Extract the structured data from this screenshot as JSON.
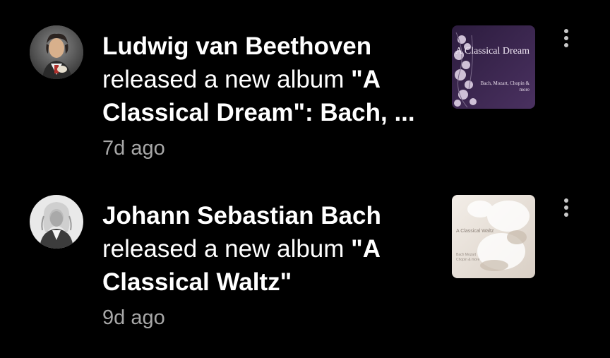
{
  "notifications": [
    {
      "artist": "Ludwig van Beethoven",
      "line2_regular": "released a new album ",
      "line2_bold": "\"A",
      "line3_bold": "Classical Dream\": Bach, ...",
      "time": "7d ago",
      "thumbnail": {
        "title": "A Classical Dream",
        "subtitle": "Bach, Mozart, Chopin & more",
        "colors": [
          "#3b2650",
          "#6a4d7c"
        ]
      },
      "avatar": "beethoven-portrait",
      "menu_icon": "more-vert-icon"
    },
    {
      "artist": "Johann Sebastian Bach",
      "line2_regular": "released a new album ",
      "line2_bold": "\"A",
      "line3_bold": "Classical Waltz\"",
      "time": "9d ago",
      "thumbnail": {
        "title": "A Classical Waltz",
        "subtitle": "Bach Mozart Chopin & more",
        "colors": [
          "#eae3dc",
          "#d7cdc3"
        ]
      },
      "avatar": "bach-portrait",
      "menu_icon": "more-vert-icon"
    }
  ],
  "colors": {
    "background": "#000000",
    "primary_text": "#ffffff",
    "secondary_text": "#a8a8a8"
  }
}
